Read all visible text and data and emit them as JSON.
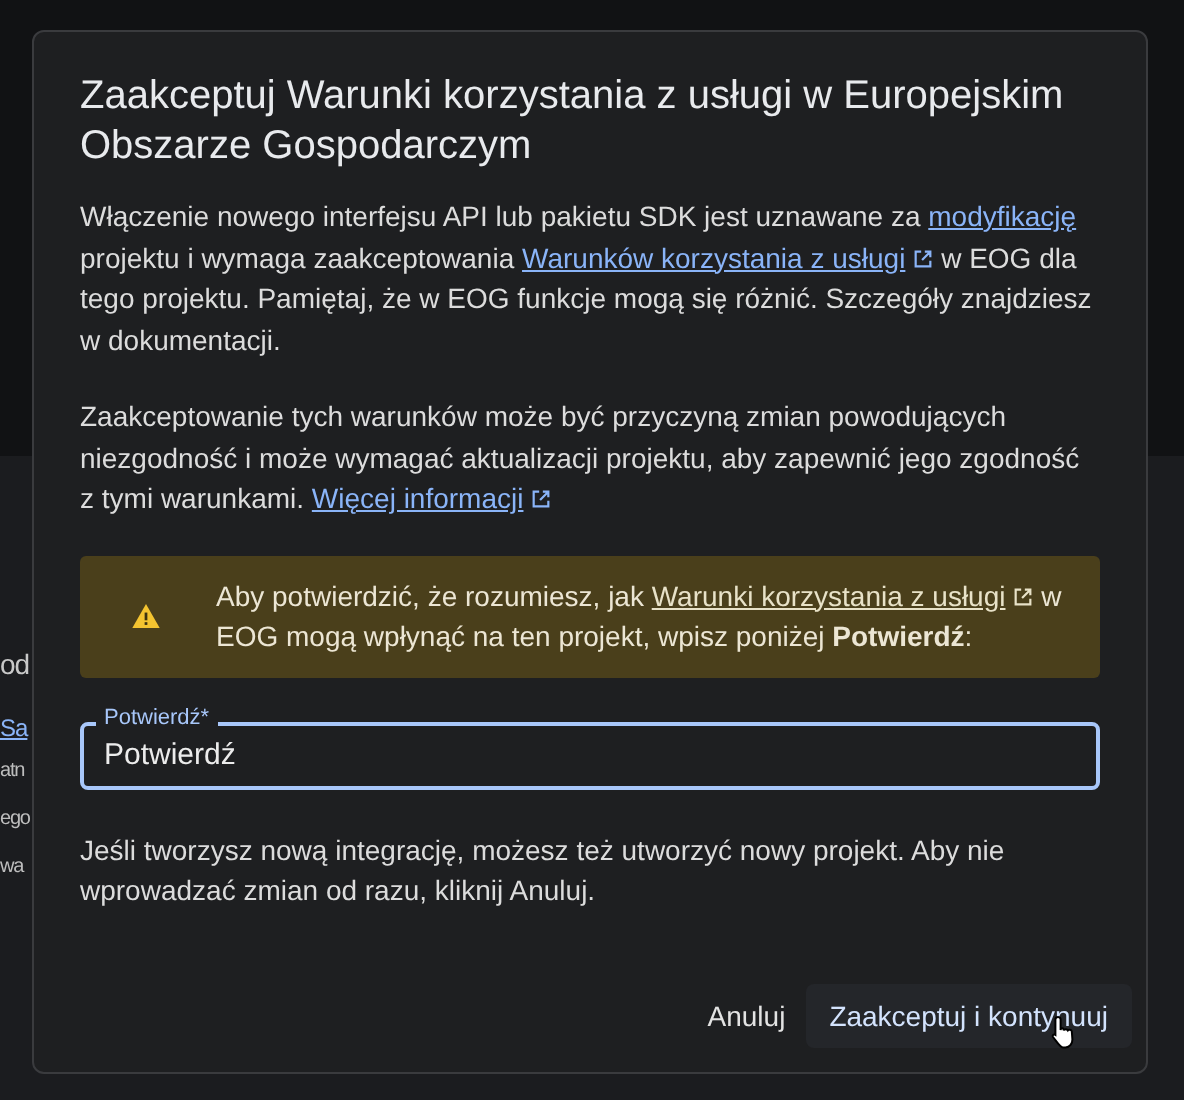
{
  "background_page": {
    "heading": "od",
    "link": "Sa",
    "lines": [
      "atn",
      "ego",
      "wa"
    ]
  },
  "dialog": {
    "title": "Zaakceptuj Warunki korzystania z usługi w Europejskim Obszarze Gospodarczym",
    "paragraphs": [
      [
        {
          "kind": "text",
          "text": "Włączenie nowego interfejsu API lub pakietu SDK jest uznawane za "
        },
        {
          "kind": "link",
          "text": "modyfikację"
        },
        {
          "kind": "text",
          "text": " projektu i wymaga zaakceptowania "
        },
        {
          "kind": "external_link",
          "text": "Warunków korzystania z usługi"
        },
        {
          "kind": "text",
          "text": " w EOG dla tego projektu. Pamiętaj, że w EOG funkcje mogą się różnić. Szczegóły znajdziesz w dokumentacji."
        }
      ],
      [
        {
          "kind": "text",
          "text": "Zaakceptowanie tych warunków może być przyczyną zmian powodujących niezgodność i może wymagać aktualizacji projektu, aby zapewnić jego zgodność z tymi warunkami. "
        },
        {
          "kind": "external_link",
          "text": "Więcej informacji"
        }
      ]
    ],
    "warning": [
      {
        "kind": "text",
        "text": "Aby potwierdzić, że rozumiesz, jak "
      },
      {
        "kind": "external_link",
        "text": "Warunki korzystania z usługi"
      },
      {
        "kind": "text",
        "text": " w EOG mogą wpłynąć na ten projekt, wpisz poniżej **Potwierdź**:"
      }
    ],
    "field": {
      "label": "Potwierdź*",
      "value": "Potwierdź"
    },
    "note": "Jeśli tworzysz nową integrację, możesz też utworzyć nowy projekt. Aby nie wprowadzać zmian od razu, kliknij Anuluj.",
    "buttons": [
      {
        "label": "Anuluj",
        "kind": "text"
      },
      {
        "label": "Zaakceptuj i kontynuuj",
        "kind": "tonal"
      }
    ]
  }
}
